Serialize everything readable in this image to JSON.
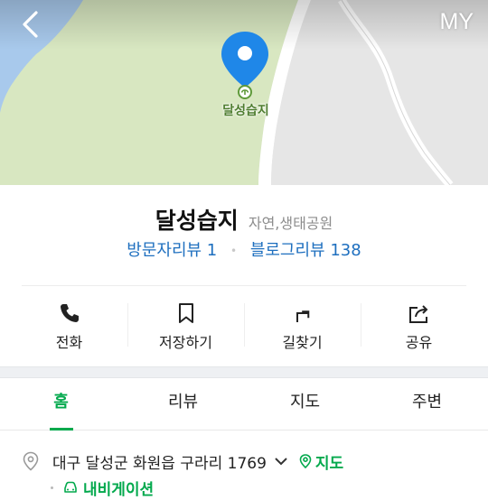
{
  "map": {
    "back_icon": "chevron-left-icon",
    "my_label": "MY",
    "pin_label": "달성습지",
    "colors": {
      "water": "#a8c9ec",
      "land": "#d8e7c1",
      "road": "#ffffff",
      "pin": "#1f87e8"
    }
  },
  "place": {
    "name": "달성습지",
    "category": "자연,생태공원",
    "visitor_review": "방문자리뷰 1",
    "blog_review": "블로그리뷰 138"
  },
  "actions": [
    {
      "label": "전화",
      "icon": "phone-icon"
    },
    {
      "label": "저장하기",
      "icon": "bookmark-icon"
    },
    {
      "label": "길찾기",
      "icon": "directions-icon"
    },
    {
      "label": "공유",
      "icon": "share-icon"
    }
  ],
  "tabs": [
    {
      "label": "홈",
      "active": true
    },
    {
      "label": "리뷰",
      "active": false
    },
    {
      "label": "지도",
      "active": false
    },
    {
      "label": "주변",
      "active": false
    }
  ],
  "address": {
    "text": "대구 달성군 화원읍 구라리 1769",
    "map_link": "지도",
    "navigation_link": "내비게이션"
  },
  "accent": "#03a94d",
  "link_blue": "#1e6fbf"
}
